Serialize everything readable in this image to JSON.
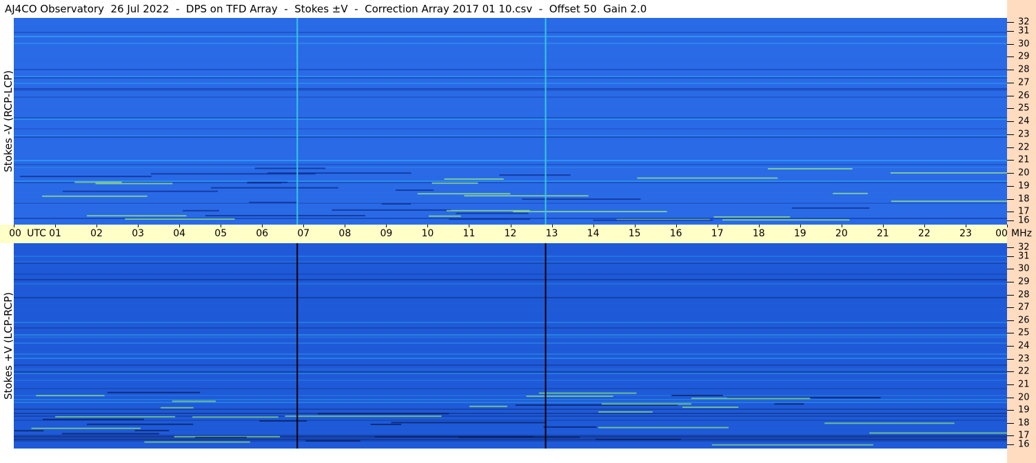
{
  "header": {
    "title": "AJ4CO Observatory  26 Jul 2022  -  DPS on TFD Array  -  Stokes ±V  -  Correction Array 2017 01 10.csv  -  Offset 50  Gain 2.0"
  },
  "chart_data": [
    {
      "type": "heatmap",
      "panel": "top",
      "ylabel": "Stokes -V (RCP-LCP)",
      "x_unit": "UTC",
      "y_unit": "MHz",
      "xlim": [
        0,
        24
      ],
      "ylim": [
        16,
        32
      ],
      "x_ticks": [
        "00",
        "01",
        "02",
        "03",
        "04",
        "05",
        "06",
        "07",
        "08",
        "09",
        "10",
        "11",
        "12",
        "13",
        "14",
        "15",
        "16",
        "17",
        "18",
        "19",
        "20",
        "21",
        "22",
        "23",
        "00"
      ],
      "y_ticks": [
        "16",
        "17",
        "18",
        "19",
        "20",
        "21",
        "22",
        "23",
        "24",
        "25",
        "26",
        "27",
        "28",
        "29",
        "30",
        "31",
        "32"
      ],
      "vertical_lines_utc": [
        6.85,
        12.85
      ],
      "vertical_line_color": "#35c8e0",
      "colors": {
        "base": "#2a6ae6",
        "dark": "#0a2a8c",
        "bright": "#30c0ff",
        "hot": "#a0f080"
      }
    },
    {
      "type": "heatmap",
      "panel": "bottom",
      "ylabel": "Stokes +V (LCP-RCP)",
      "x_unit": "UTC",
      "y_unit": "MHz",
      "xlim": [
        0,
        24
      ],
      "ylim": [
        16,
        32
      ],
      "x_ticks": [
        "00",
        "01",
        "02",
        "03",
        "04",
        "05",
        "06",
        "07",
        "08",
        "09",
        "10",
        "11",
        "12",
        "13",
        "14",
        "15",
        "16",
        "17",
        "18",
        "19",
        "20",
        "21",
        "22",
        "23",
        "00"
      ],
      "y_ticks": [
        "16",
        "17",
        "18",
        "19",
        "20",
        "21",
        "22",
        "23",
        "24",
        "25",
        "26",
        "27",
        "28",
        "29",
        "30",
        "31",
        "32"
      ],
      "vertical_lines_utc": [
        6.85,
        12.85
      ],
      "vertical_line_color": "#000000",
      "colors": {
        "base": "#1f5ad8",
        "dark": "#061a5a",
        "bright": "#2ea8f0",
        "hot": "#90e878"
      }
    }
  ],
  "time_axis": {
    "utc_label": "UTC",
    "mhz_label": "MHz"
  }
}
